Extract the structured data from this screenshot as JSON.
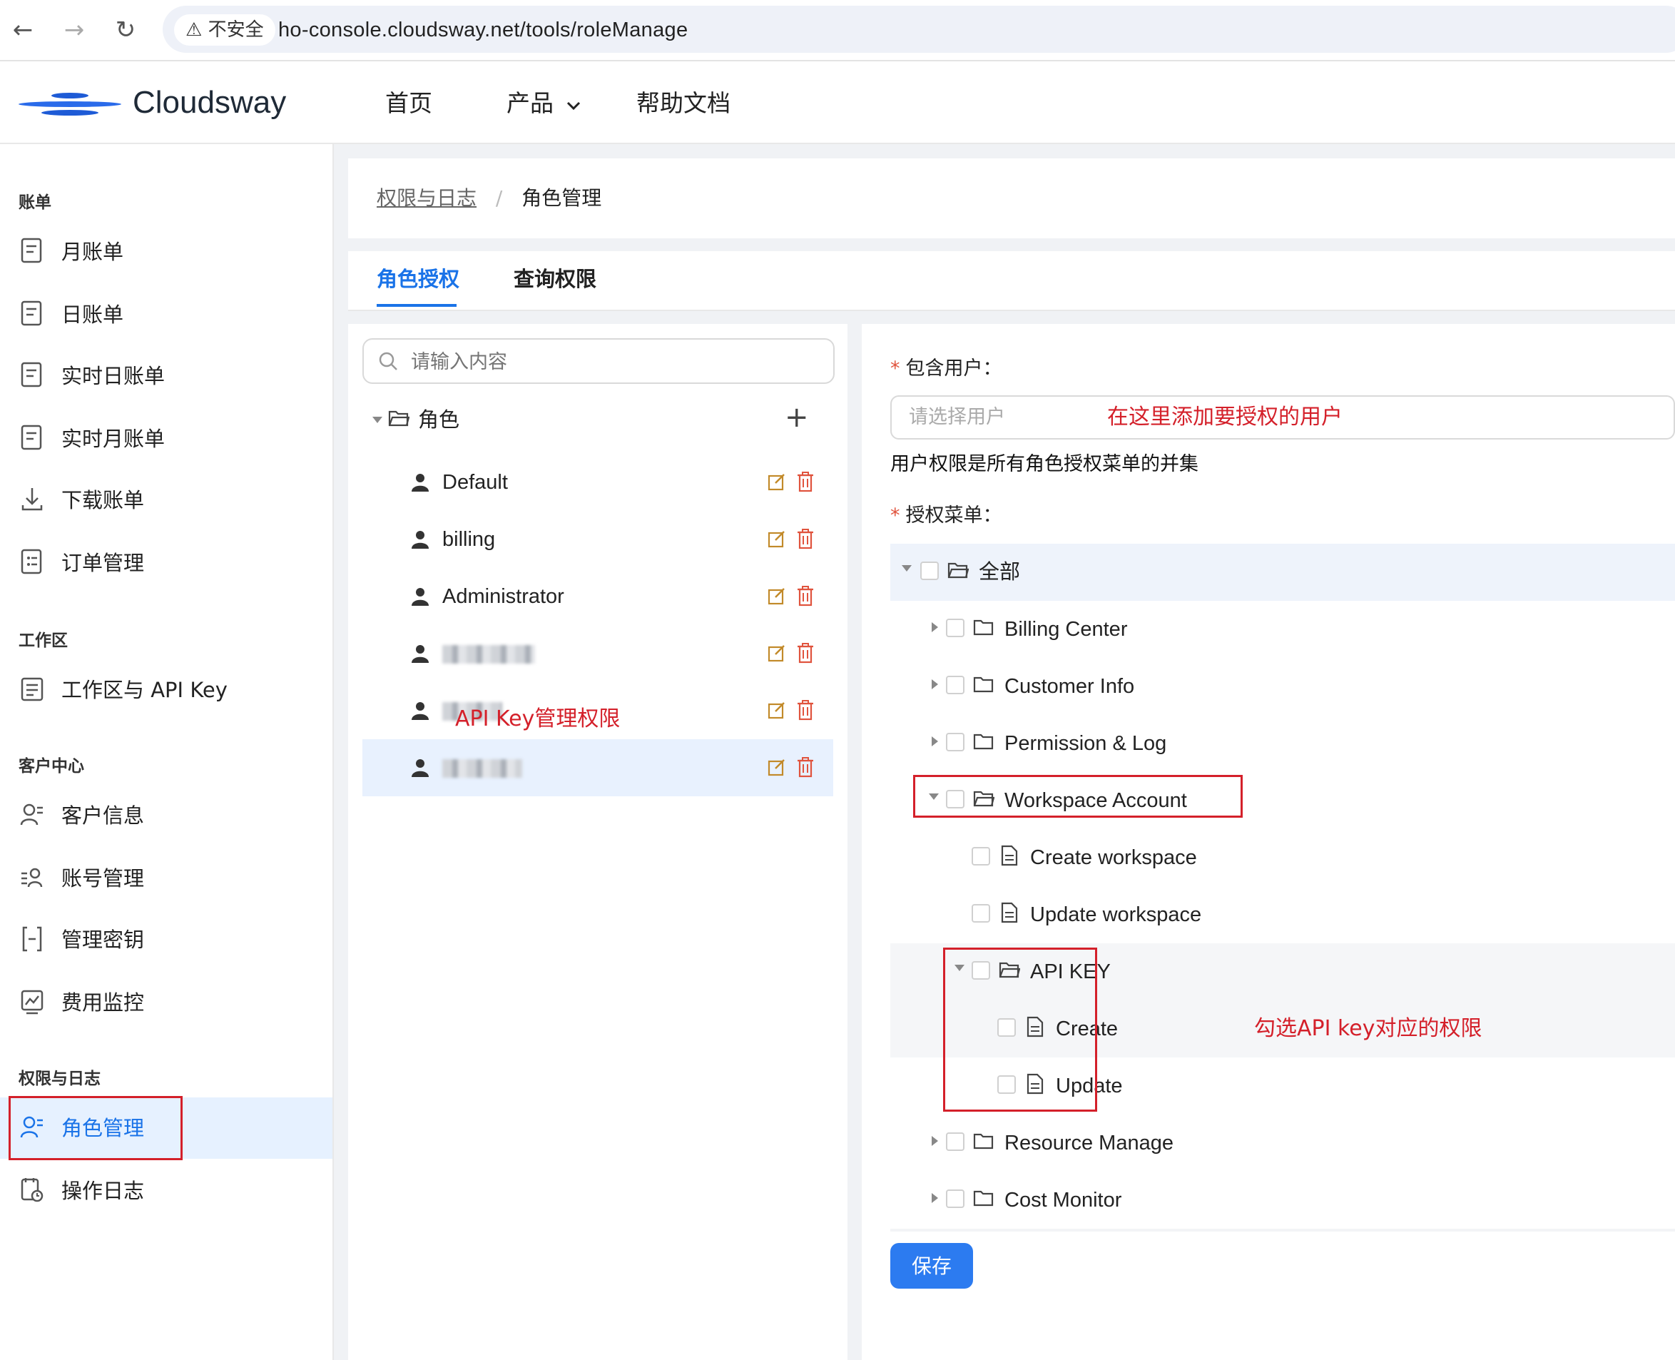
{
  "browser": {
    "security_label": "不安全",
    "url": "ho-console.cloudsway.net/tools/roleManage"
  },
  "header": {
    "brand": "Cloudsway",
    "nav": [
      "首页",
      "产品",
      "帮助文档"
    ]
  },
  "sidebar": {
    "sections": [
      {
        "title": "账单",
        "items": [
          "月账单",
          "日账单",
          "实时日账单",
          "实时月账单",
          "下载账单",
          "订单管理"
        ]
      },
      {
        "title": "工作区",
        "items": [
          "工作区与 API Key"
        ]
      },
      {
        "title": "客户中心",
        "items": [
          "客户信息",
          "账号管理",
          "管理密钥",
          "费用监控"
        ]
      },
      {
        "title": "权限与日志",
        "items": [
          "角色管理",
          "操作日志"
        ]
      }
    ],
    "active_item": "角色管理"
  },
  "breadcrumb": {
    "parent": "权限与日志",
    "separator": "/",
    "current": "角色管理"
  },
  "tabs": [
    "角色授权",
    "查询权限"
  ],
  "active_tab": "角色授权",
  "role_panel": {
    "search_placeholder": "请输入内容",
    "root_label": "角色",
    "roles": [
      "Default",
      "billing",
      "Administrator"
    ]
  },
  "form": {
    "users_label": "包含用户：",
    "users_placeholder": "请选择用户",
    "users_annotation": "在这里添加要授权的用户",
    "hint": "用户权限是所有角色授权菜单的并集",
    "menu_label": "授权菜单：",
    "required_mark": "*"
  },
  "tree": {
    "root": "全部",
    "nodes": [
      "Billing Center",
      "Customer Info",
      "Permission & Log",
      "Workspace Account",
      "Create workspace",
      "Update workspace",
      "API KEY",
      "Create",
      "Update",
      "Resource Manage",
      "Cost Monitor"
    ]
  },
  "annotations": {
    "api_key_role": "API Key管理权限",
    "api_key_perm": "勾选API key对应的权限"
  },
  "save_label": "保存",
  "colors": {
    "accent": "#1a73e8",
    "annotation": "#d4202a",
    "delete": "#e0533d",
    "edit": "#c28a2a"
  }
}
